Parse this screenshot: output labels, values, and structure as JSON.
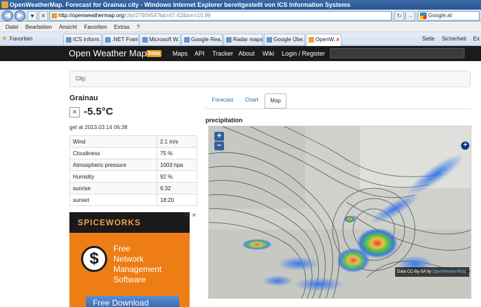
{
  "browser": {
    "title": "OpenWeatherMap. Forecast for Grainau city - Windows Internet Explorer bereitgestellt von ICS Information Systems",
    "url_host": "http://openweathermap.org",
    "url_path": "/city/2760454?lat=47.42&lon=10.99",
    "search_value": "Google.at",
    "menu": [
      "Datei",
      "Bearbeiten",
      "Ansicht",
      "Favoriten",
      "Extras",
      "?"
    ],
    "favorites_label": "Favoriten",
    "tabs": [
      "ICS Inform...",
      ".NET Frame...",
      "Microsoft W...",
      "Google Rea...",
      "Radar maps",
      "Google Übe...",
      "OpenW..."
    ],
    "commands": [
      "Seite",
      "Sicherheit",
      "Ex"
    ]
  },
  "owm": {
    "brand": "Open Weather Map",
    "beta": "beta",
    "nav": [
      "Maps",
      "API",
      "Tracker",
      "About",
      "Wiki",
      "Login / Register"
    ]
  },
  "city_label": "City:",
  "city": {
    "name": "Grainau",
    "temperature": "-5.5°C",
    "updated": "get at 2013.03.14 06:38",
    "rows": [
      {
        "label": "Wind",
        "value": "2.1 m/s"
      },
      {
        "label": "Cloudiness",
        "value": "75 %"
      },
      {
        "label": "Atmospheric pressure",
        "value": "1003 hpa"
      },
      {
        "label": "Humidity",
        "value": "92 %"
      },
      {
        "label": "sunrise",
        "value": "6:32"
      },
      {
        "label": "sunset",
        "value": "18:20"
      }
    ]
  },
  "ad": {
    "brand": "SPICEWORKS",
    "lines": [
      "Free",
      "Network",
      "Management",
      "Software"
    ],
    "button": "Free Download"
  },
  "panel": {
    "tabs": [
      "Forecast",
      "Chart",
      "Map"
    ],
    "active_tab": "Map",
    "section_title": "precipitation",
    "attribution_prefix": "Data CC-By-SA by",
    "attribution_link": "OpenWeatherMap"
  },
  "colors": {
    "header_bg": "#1b1b1b",
    "beta_badge": "#f0a020",
    "ad_orange": "#ef7d15",
    "link_blue": "#2f63b0"
  }
}
